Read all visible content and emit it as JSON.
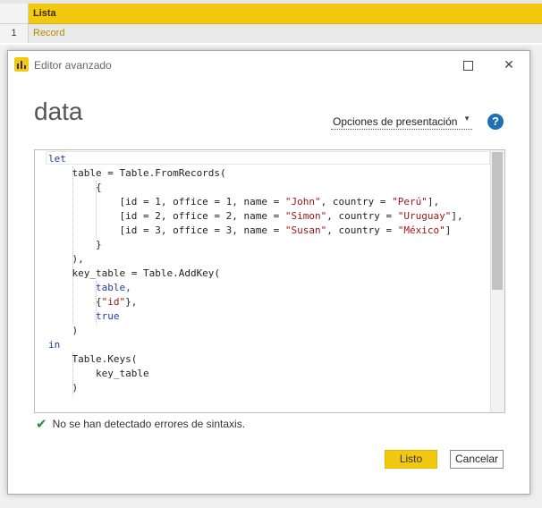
{
  "grid": {
    "column_header": "Lista",
    "rows": [
      {
        "num": "1",
        "value": "Record"
      }
    ]
  },
  "dialog": {
    "title": "Editor avanzado",
    "heading": "data",
    "options_label": "Opciones de presentación",
    "help_label": "?",
    "status": "No se han detectado errores de sintaxis.",
    "done_label": "Listo",
    "cancel_label": "Cancelar",
    "colors": {
      "accent": "#f2c811",
      "keyword": "#1f3aa8",
      "string": "#a31515",
      "success": "#2e8b3d",
      "help": "#1f6fb5"
    }
  },
  "code_lines": [
    [
      [
        "let",
        "kw"
      ]
    ],
    [
      [
        "    table = Table.FromRecords(",
        "fn"
      ]
    ],
    [
      [
        "        {",
        "fn"
      ]
    ],
    [
      [
        "            [id = 1, office = 1, name = ",
        "fn"
      ],
      [
        "\"John\"",
        "str"
      ],
      [
        ", country = ",
        "fn"
      ],
      [
        "\"Perú\"",
        "str"
      ],
      [
        "],",
        "fn"
      ]
    ],
    [
      [
        "            [id = 2, office = 2, name = ",
        "fn"
      ],
      [
        "\"Simon\"",
        "str"
      ],
      [
        ", country = ",
        "fn"
      ],
      [
        "\"Uruguay\"",
        "str"
      ],
      [
        "],",
        "fn"
      ]
    ],
    [
      [
        "            [id = 3, office = 3, name = ",
        "fn"
      ],
      [
        "\"Susan\"",
        "str"
      ],
      [
        ", country = ",
        "fn"
      ],
      [
        "\"México\"",
        "str"
      ],
      [
        "]",
        "fn"
      ]
    ],
    [
      [
        "        }",
        "fn"
      ]
    ],
    [
      [
        "    ),",
        "fn"
      ]
    ],
    [
      [
        "    key_table = Table.AddKey(",
        "fn"
      ]
    ],
    [
      [
        "        table,",
        "kw"
      ]
    ],
    [
      [
        "        {",
        "fn"
      ],
      [
        "\"id\"",
        "str"
      ],
      [
        "},",
        "fn"
      ]
    ],
    [
      [
        "        true",
        "kw"
      ]
    ],
    [
      [
        "    )",
        "fn"
      ]
    ],
    [
      [
        "in",
        "kw"
      ]
    ],
    [
      [
        "    Table.Keys(",
        "fn"
      ]
    ],
    [
      [
        "        key_table",
        "fn"
      ]
    ],
    [
      [
        "    )",
        "fn"
      ]
    ]
  ]
}
